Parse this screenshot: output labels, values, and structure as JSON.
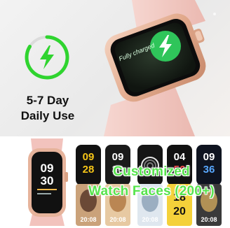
{
  "battery": {
    "line1": "5-7 Day",
    "line2": "Daily Use",
    "ring_color": "#2fd42f",
    "icon": "lightning-bolt-icon"
  },
  "hero_watch": {
    "screen_text": "Fully charged",
    "screen_color": "#1f2b20",
    "badge_color": "#2fc55a",
    "case_color": "#e7b59b",
    "strap_color": "#f2c9c2"
  },
  "faces_banner": {
    "line1": "Customized",
    "line2": "Watch Faces (200+)",
    "caption_color": "#57e44d"
  },
  "thumb_watch": {
    "hour": "09",
    "minute": "30"
  },
  "watch_faces_top": [
    {
      "time1": "09",
      "time2": "28",
      "style": "yellow-digits"
    },
    {
      "time1": "09",
      "time2": "30",
      "style": "black-white"
    },
    {
      "time1": "",
      "time2": "",
      "style": "rings"
    },
    {
      "time1": "04",
      "time2": "56",
      "style": "bold-black"
    },
    {
      "time1": "09",
      "time2": "36",
      "style": "blue-accent"
    }
  ],
  "watch_faces_bottom": [
    {
      "time1": "20:08",
      "time2": "",
      "style": "photo-person"
    },
    {
      "time1": "20:08",
      "time2": "",
      "style": "photo-dog"
    },
    {
      "time1": "20:08",
      "time2": "",
      "style": "photo-light"
    },
    {
      "time1": "18",
      "time2": "20",
      "style": "yellow-block"
    },
    {
      "time1": "20:08",
      "time2": "",
      "style": "photo-city"
    }
  ]
}
